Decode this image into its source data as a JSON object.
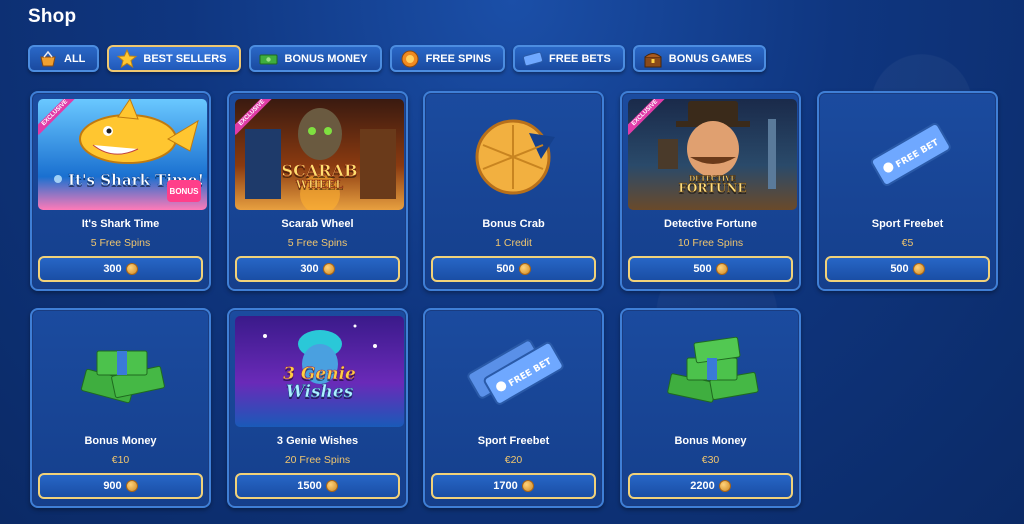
{
  "page": {
    "title": "Shop"
  },
  "tabs": [
    {
      "label": "ALL",
      "icon": "basket-icon",
      "active": false
    },
    {
      "label": "BEST SELLERS",
      "icon": "star-icon",
      "active": true
    },
    {
      "label": "BONUS MONEY",
      "icon": "money-icon",
      "active": false
    },
    {
      "label": "FREE SPINS",
      "icon": "spin-icon",
      "active": false
    },
    {
      "label": "FREE BETS",
      "icon": "ticket-icon",
      "active": false
    },
    {
      "label": "BONUS GAMES",
      "icon": "treasure-icon",
      "active": false
    }
  ],
  "colors": {
    "accent_gold": "#f0c66e",
    "exclusive_badge": "#e03ca8"
  },
  "cards": [
    {
      "name": "It's Shark Time",
      "sub": "5 Free Spins",
      "price": "300",
      "badge": "EXCLUSIVE",
      "art": "It's Shark Time!",
      "art_extra": "BONUS"
    },
    {
      "name": "Scarab Wheel",
      "sub": "5 Free Spins",
      "price": "300",
      "badge": "EXCLUSIVE",
      "art": "SCARAB",
      "art_extra": "WHEEL"
    },
    {
      "name": "Bonus Crab",
      "sub": "1 Credit",
      "price": "500"
    },
    {
      "name": "Detective Fortune",
      "sub": "10 Free Spins",
      "price": "500",
      "badge": "EXCLUSIVE",
      "art": "DETECTIVE",
      "art_extra": "FORTUNE"
    },
    {
      "name": "Sport Freebet",
      "sub": "€5",
      "price": "500",
      "art": "FREE BET"
    },
    {
      "name": "Bonus Money",
      "sub": "€10",
      "price": "900"
    },
    {
      "name": "3 Genie Wishes",
      "sub": "20 Free Spins",
      "price": "1500",
      "art": "3 Genie",
      "art_extra": "Wishes"
    },
    {
      "name": "Sport Freebet",
      "sub": "€20",
      "price": "1700",
      "art": "FREE BET"
    },
    {
      "name": "Bonus Money",
      "sub": "€30",
      "price": "2200"
    }
  ]
}
